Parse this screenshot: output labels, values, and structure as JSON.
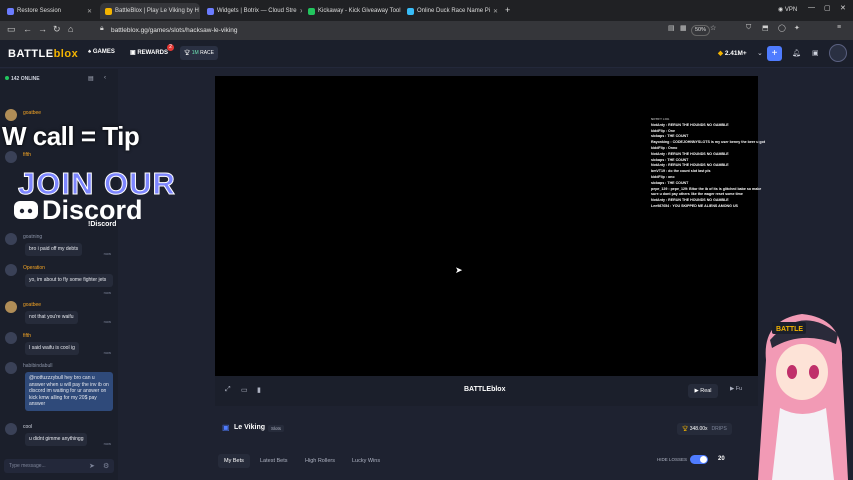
{
  "browser": {
    "tabs": [
      {
        "label": "Restore Session",
        "active": false
      },
      {
        "label": "BattleBlox | Play Le Viking by H",
        "active": true
      },
      {
        "label": "Widgets | Botrix — Cloud Stre",
        "active": false
      },
      {
        "label": "Kickaway - Kick Giveaway Tool",
        "active": false
      },
      {
        "label": "Online Duck Race Name Pi",
        "active": false
      }
    ],
    "url": "battleblox.gg/games/slots/hacksaw-le-viking",
    "zoom": "50%",
    "vpn": "VPN"
  },
  "site": {
    "logo_a": "BATTLE",
    "logo_b": "blox",
    "nav": {
      "games": "GAMES",
      "rewards": "REWARDS",
      "rewards_badge": "2"
    },
    "rakeback": {
      "value": "1M",
      "label": "RACE"
    },
    "balance": "2.41M+",
    "plus": "+"
  },
  "chat": {
    "online": "142 ONLINE",
    "messages": [
      {
        "name": "goatbee",
        "text": "",
        "time": ""
      },
      {
        "name": "fifth",
        "text": "",
        "time": ""
      },
      {
        "name": "goatning",
        "text": "bro i paid off my debts",
        "time": "now"
      },
      {
        "name": "Operation",
        "text": "yo, im about to fly some fighter jets",
        "time": "now"
      },
      {
        "name": "goatbee",
        "text": "not that you're waifu",
        "time": "now"
      },
      {
        "name": "fifth",
        "text": "I said waifu is cool ig",
        "time": "now"
      },
      {
        "name": "habibindabull",
        "text": "@notfuzzzybull hey bro can u answer when u will pay the inv ib on discord im waiting for ur answer on kick kmw alling for my 20$ pay answer",
        "time": "now"
      },
      {
        "name": "cool",
        "text": "u didnt gimme anythingg",
        "time": "now"
      }
    ],
    "input_placeholder": "Type message..."
  },
  "overlay": {
    "tip_call": "W call = Tip",
    "join_our": "JOIN OUR",
    "discord": "Discord",
    "discord_cmd": "!Discord"
  },
  "game_log": {
    "header": "NOTIFY LOG",
    "lines": [
      "NotAnty : RERUN THE HOUNDS NO GAMBLE",
      "kiddFlip : One",
      "sickaps : THE COUNT",
      "Rayonking : CODEJOHNNYSLOTS is my user benny the beer u got 270k u got me?",
      "kiddFlip : Onno",
      "NotAnty : RERUN THE HOUNDS NO GAMBLE",
      "sickaps : THE COUNT",
      "NotAnty : RERUN THE HOUNDS NO GAMBLE",
      "bmVT19 : do the count slot last pls",
      "kiddFlip : ono",
      "sickaps : THE COUNT",
      "pepe_129 : pepe_129: Bitor the ib of its is glitched babe so make sure u dont pay others like the wager reset some time",
      "NotAnty : RERUN THE HOUNDS NO GAMBLE",
      "Lee987654 : YOU SKIPPED ME ALIENS AMONG US"
    ]
  },
  "game": {
    "bar_logo": "BATTLEblox",
    "real_label": "Real",
    "fun_label": "Fu",
    "title": "Le Viking",
    "category": "Slots",
    "max_win": "348.00x",
    "max_win_label": "DRIPS"
  },
  "bets": {
    "tabs": [
      "My Bets",
      "Latest Bets",
      "High Rollers",
      "Lucky Wins"
    ],
    "hide_losses": "HIDE LOSSES",
    "row_count": "20"
  },
  "colors": {
    "accent": "#4f7cff",
    "brand": "#f4b400",
    "discord": "#7d86ff"
  }
}
